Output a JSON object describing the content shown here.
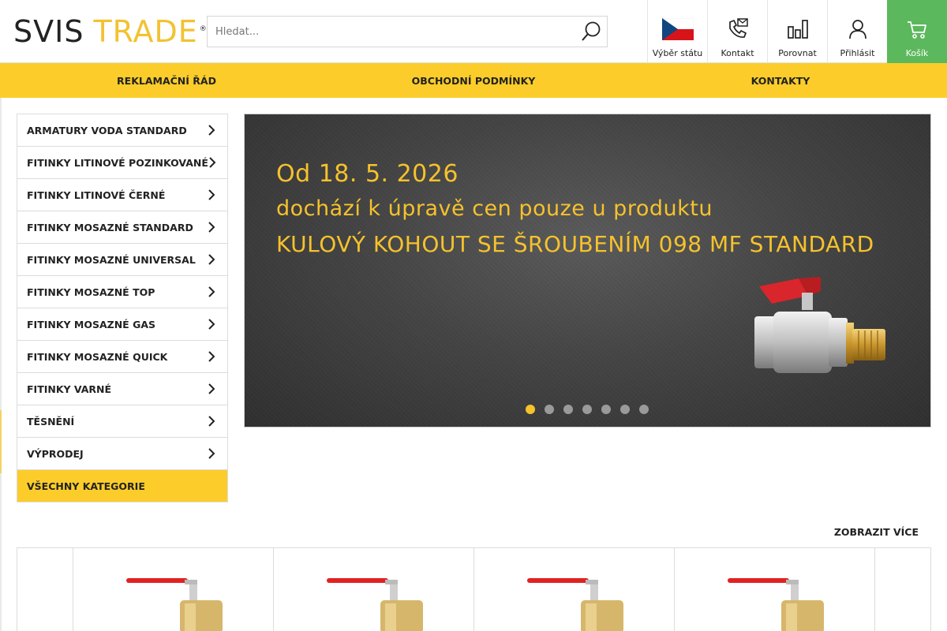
{
  "header": {
    "logo": {
      "part1": "SVIS",
      "part2": "TRADE",
      "mark": "®"
    },
    "search": {
      "placeholder": "Hledat...",
      "value": "",
      "icon": "search-icon"
    },
    "buttons": [
      {
        "label": "Výběr státu",
        "icon": "czech-flag-icon"
      },
      {
        "label": "Kontakt",
        "icon": "phone-mail-icon"
      },
      {
        "label": "Porovnat",
        "icon": "compare-bars-icon"
      },
      {
        "label": "Přihlásit",
        "icon": "user-icon"
      },
      {
        "label": "Košík",
        "icon": "cart-icon"
      }
    ],
    "colors": {
      "accent_yellow": "#fccd2a",
      "cart_green": "#5cb85c",
      "logo_yellow": "#f2c230"
    }
  },
  "topnav": {
    "items": [
      {
        "label": "REKLAMAČNÍ ŘÁD"
      },
      {
        "label": "OBCHODNÍ PODMÍNKY"
      },
      {
        "label": "KONTAKTY"
      }
    ]
  },
  "categories": {
    "items": [
      {
        "label": "ARMATURY VODA STANDARD"
      },
      {
        "label": "FITINKY LITINOVÉ POZINKOVANÉ"
      },
      {
        "label": "FITINKY LITINOVÉ ČERNÉ"
      },
      {
        "label": "FITINKY MOSAZNÉ STANDARD"
      },
      {
        "label": "FITINKY MOSAZNÉ UNIVERSAL"
      },
      {
        "label": "FITINKY MOSAZNÉ TOP"
      },
      {
        "label": "FITINKY MOSAZNÉ GAS"
      },
      {
        "label": "FITINKY MOSAZNÉ QUICK"
      },
      {
        "label": "FITINKY VARNÉ"
      },
      {
        "label": "TĚSNĚNÍ"
      },
      {
        "label": "VÝPRODEJ"
      }
    ],
    "all_label": "VŠECHNY KATEGORIE"
  },
  "banner": {
    "line1": "Od 18. 5. 2026",
    "line2": "dochází k úpravě cen pouze u produktu",
    "line3": "KULOVÝ KOHOUT SE ŠROUBENÍM 098 MF STANDARD",
    "slides_total": 7,
    "active_slide": 1,
    "text_color": "#f6c22c"
  },
  "products": {
    "more_label": "ZOBRAZIT VÍCE",
    "cards": [
      {
        "icon": "ball-valve-icon"
      },
      {
        "icon": "ball-valve-icon"
      },
      {
        "icon": "ball-valve-icon"
      },
      {
        "icon": "ball-valve-icon"
      }
    ]
  }
}
